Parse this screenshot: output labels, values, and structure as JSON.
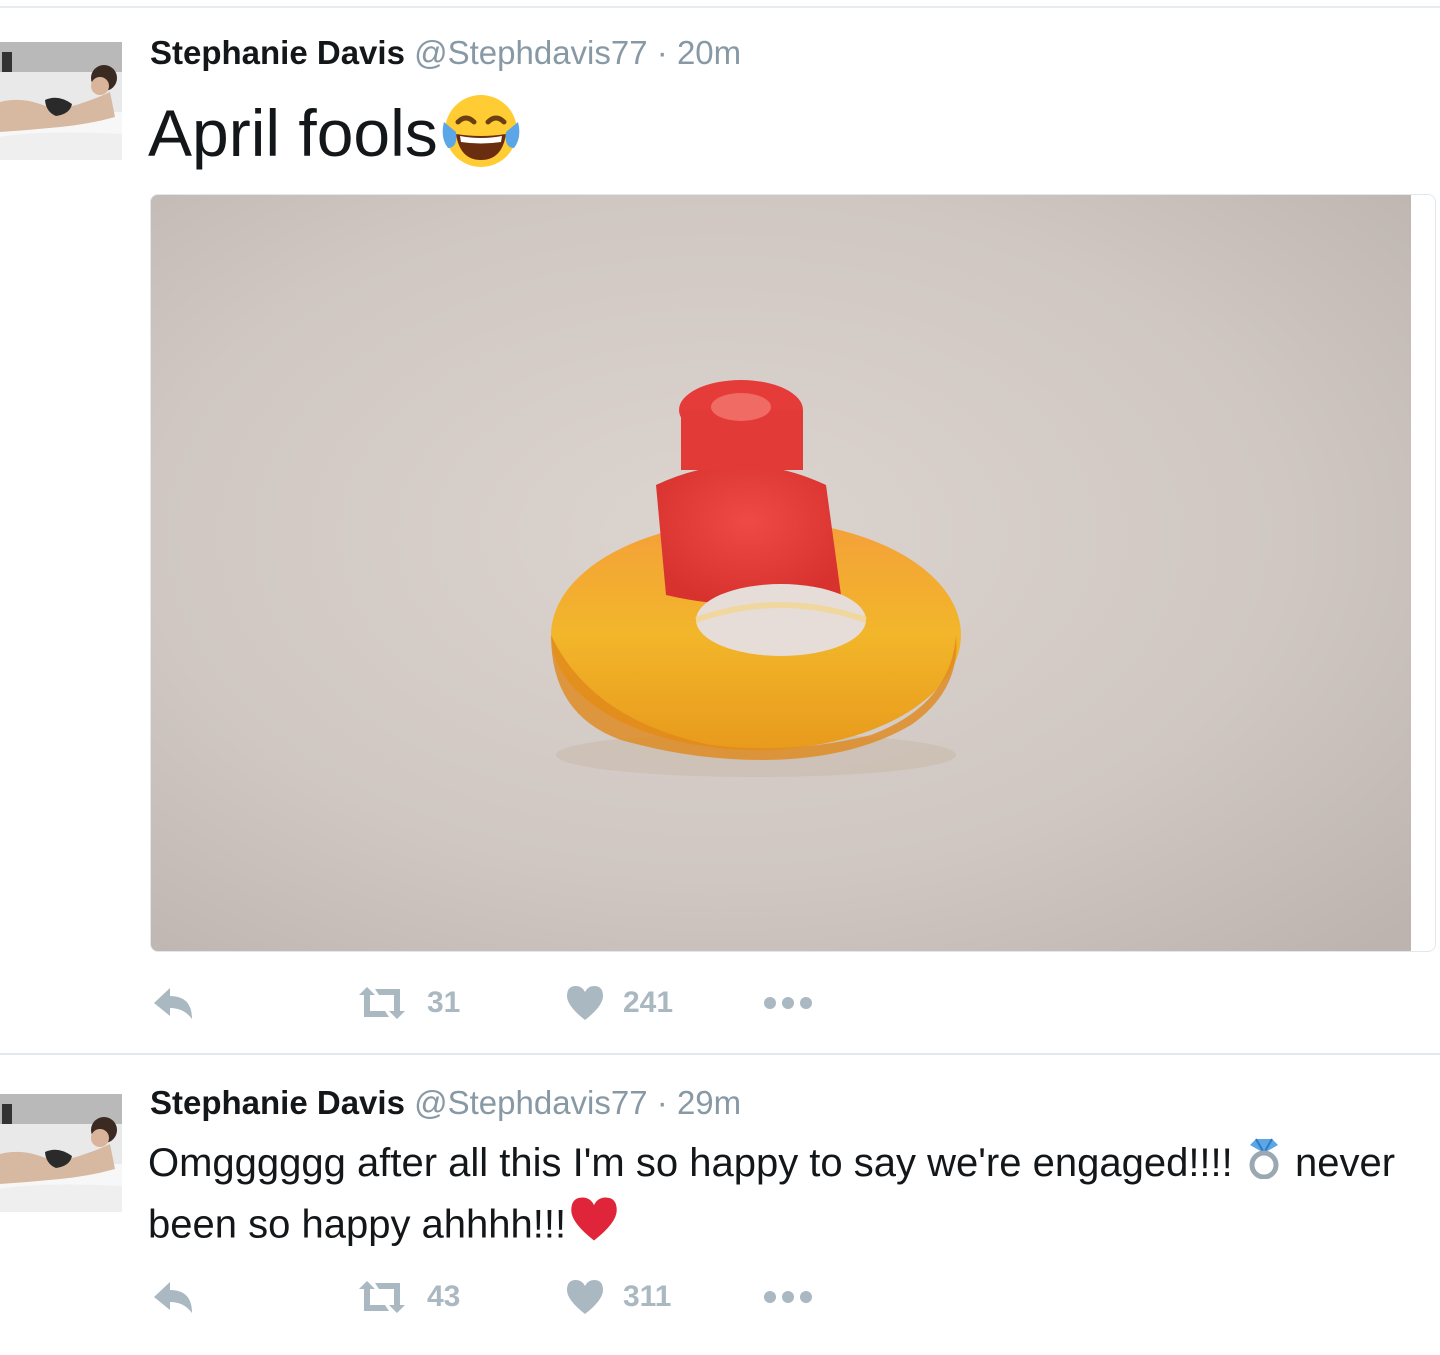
{
  "tweets": [
    {
      "author_name": "Stephanie Davis",
      "handle": "@Stephdavis77",
      "separator": "·",
      "time": "20m",
      "text": "April fools",
      "emoji": "face-with-tears-of-joy",
      "has_media": true,
      "retweets": "31",
      "likes": "241"
    },
    {
      "author_name": "Stephanie Davis",
      "handle": "@Stephdavis77",
      "separator": "·",
      "time": "29m",
      "text_part1": "Omgggggg after all this I'm so happy to say we're engaged!!!! ",
      "text_part2": " never been so happy ahhhh!!!",
      "emoji_ring": "ring",
      "emoji_heart": "red-heart",
      "retweets": "43",
      "likes": "311"
    }
  ],
  "icons": {
    "reply": "reply-icon",
    "retweet": "retweet-icon",
    "like": "heart-icon",
    "more": "more-icon"
  },
  "colors": {
    "action_gray": "#aab8c2",
    "secondary_text": "#8899a6",
    "heart_red": "#e0243a"
  }
}
